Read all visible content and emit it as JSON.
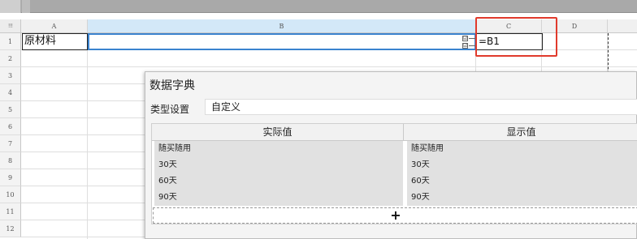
{
  "columns": [
    "A",
    "B",
    "C",
    "D"
  ],
  "rows": [
    "1",
    "2",
    "3",
    "4",
    "5",
    "6",
    "7",
    "8",
    "9",
    "10",
    "11",
    "12"
  ],
  "corner_glyph": "!!!",
  "cells": {
    "A1": "原材料",
    "C1": "=B1"
  },
  "checkbox_glyph": "☑",
  "accent_colors": {
    "selection": "#3a83cf",
    "highlight_box": "#e03a2c"
  },
  "dialog": {
    "title": "数据字典",
    "type_label": "类型设置",
    "type_value": "自定义",
    "table": {
      "headers": [
        "实际值",
        "显示值"
      ],
      "rows": [
        [
          "随买随用",
          "随买随用"
        ],
        [
          "30天",
          "30天"
        ],
        [
          "60天",
          "60天"
        ],
        [
          "90天",
          "90天"
        ]
      ]
    },
    "add_label": "+"
  }
}
